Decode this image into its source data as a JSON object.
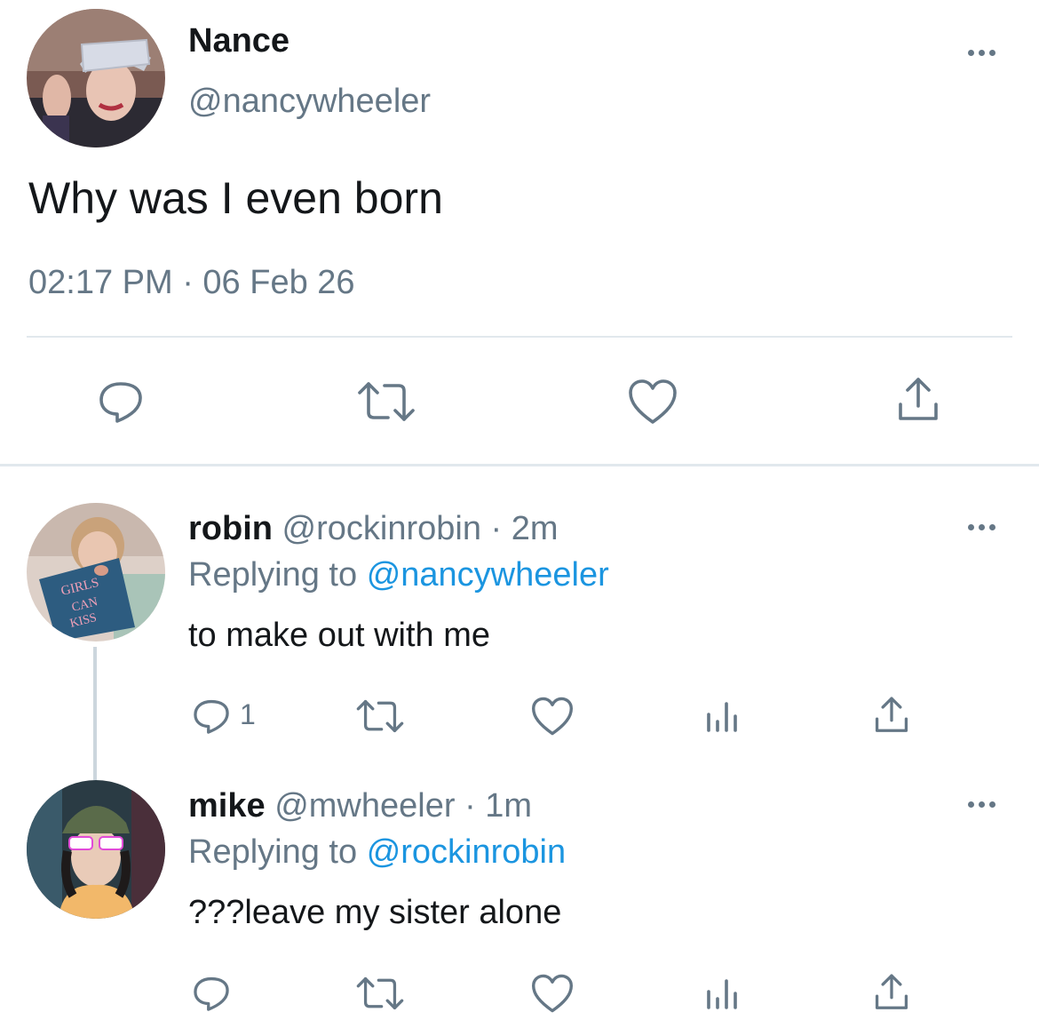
{
  "main_tweet": {
    "display_name": "Nance",
    "handle": "@nancywheeler",
    "text": "Why was I even born",
    "timestamp": "02:17 PM · 06 Feb 26",
    "avatar": "avatar-nancy"
  },
  "replies": [
    {
      "display_name": "robin",
      "handle": "@rockinrobin",
      "time": "· 2m",
      "replying_prefix": "Replying to",
      "replying_to": "@nancywheeler",
      "text": "to make out with me",
      "reply_count": "1",
      "book_text": "GIRLS CAN KISS NOW"
    },
    {
      "display_name": "mike",
      "handle": "@mwheeler",
      "time": "· 1m",
      "replying_prefix": "Replying to",
      "replying_to": "@rockinrobin",
      "text": "???leave my sister alone",
      "reply_count": ""
    }
  ],
  "icons": [
    "reply-icon",
    "retweet-icon",
    "like-icon",
    "share-icon",
    "analytics-icon",
    "more-icon"
  ],
  "colors": {
    "link": "#1b95e0",
    "muted": "#657786",
    "text": "#14171a",
    "divider": "#e1e8ed"
  }
}
